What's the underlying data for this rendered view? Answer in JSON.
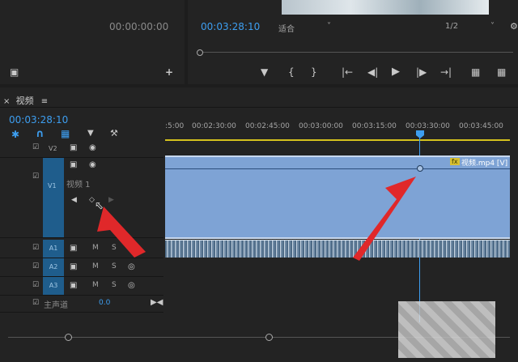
{
  "source_monitor": {
    "timecode": "00:00:00:00"
  },
  "program_monitor": {
    "timecode": "00:03:28:10",
    "fit": "适合",
    "resolution": "1/2"
  },
  "timeline": {
    "tab_title": "视频",
    "timecode": "00:03:28:10",
    "ruler_labels": [
      ":5:00",
      "00:02:30:00",
      "00:02:45:00",
      "00:03:00:00",
      "00:03:15:00",
      "00:03:30:00",
      "00:03:45:00"
    ],
    "tracks": {
      "v2": "V2",
      "v1": "V1",
      "v1_name": "视频 1",
      "a1": "A1",
      "a2": "A2",
      "a3": "A3",
      "m": "M",
      "s": "S",
      "master": "主声道",
      "master_value": "0.0"
    },
    "clip_label": "视频.mp4 [V]",
    "fx_badge": "fx"
  },
  "colors": {
    "accent": "#3d9ef0",
    "clip": "#7ea3d5",
    "track_blue": "#1f5d8c",
    "arrow": "#e0282a"
  }
}
